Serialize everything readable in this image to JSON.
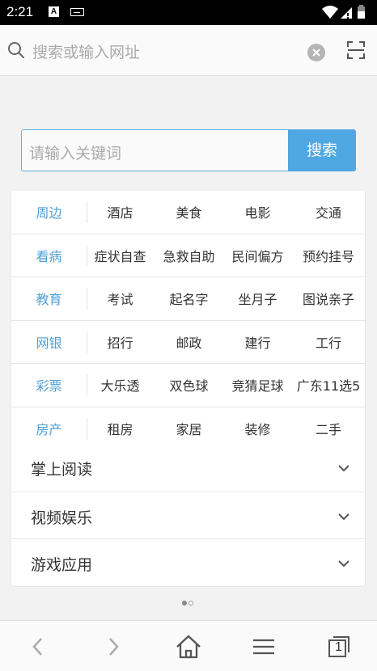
{
  "status_bar": {
    "time": "2:21",
    "notification_icons": [
      "a-icon",
      "keyboard-icon"
    ],
    "system_icons": [
      "wifi-icon",
      "signal-icon",
      "battery-icon"
    ]
  },
  "search_bar": {
    "placeholder": "搜索或输入网址"
  },
  "keyword_search": {
    "placeholder": "请输入关键词",
    "button_label": "搜索",
    "accent_color": "#4fa8e2"
  },
  "categories": [
    {
      "name": "周边",
      "items": [
        "酒店",
        "美食",
        "电影",
        "交通"
      ]
    },
    {
      "name": "看病",
      "items": [
        "症状自查",
        "急救自助",
        "民间偏方",
        "预约挂号"
      ]
    },
    {
      "name": "教育",
      "items": [
        "考试",
        "起名字",
        "坐月子",
        "图说亲子"
      ]
    },
    {
      "name": "网银",
      "items": [
        "招行",
        "邮政",
        "建行",
        "工行"
      ]
    },
    {
      "name": "彩票",
      "items": [
        "大乐透",
        "双色球",
        "竞猜足球",
        "广东11选5"
      ]
    },
    {
      "name": "房产",
      "items": [
        "租房",
        "家居",
        "装修",
        "二手"
      ]
    }
  ],
  "sections": [
    {
      "label": "掌上阅读"
    },
    {
      "label": "视频娱乐"
    },
    {
      "label": "游戏应用"
    }
  ],
  "pager": {
    "current": 1,
    "total": 2
  },
  "bottom_nav": {
    "icons": [
      "back-icon",
      "forward-icon",
      "home-icon",
      "menu-icon",
      "tabs-icon"
    ],
    "tab_count": "1"
  }
}
